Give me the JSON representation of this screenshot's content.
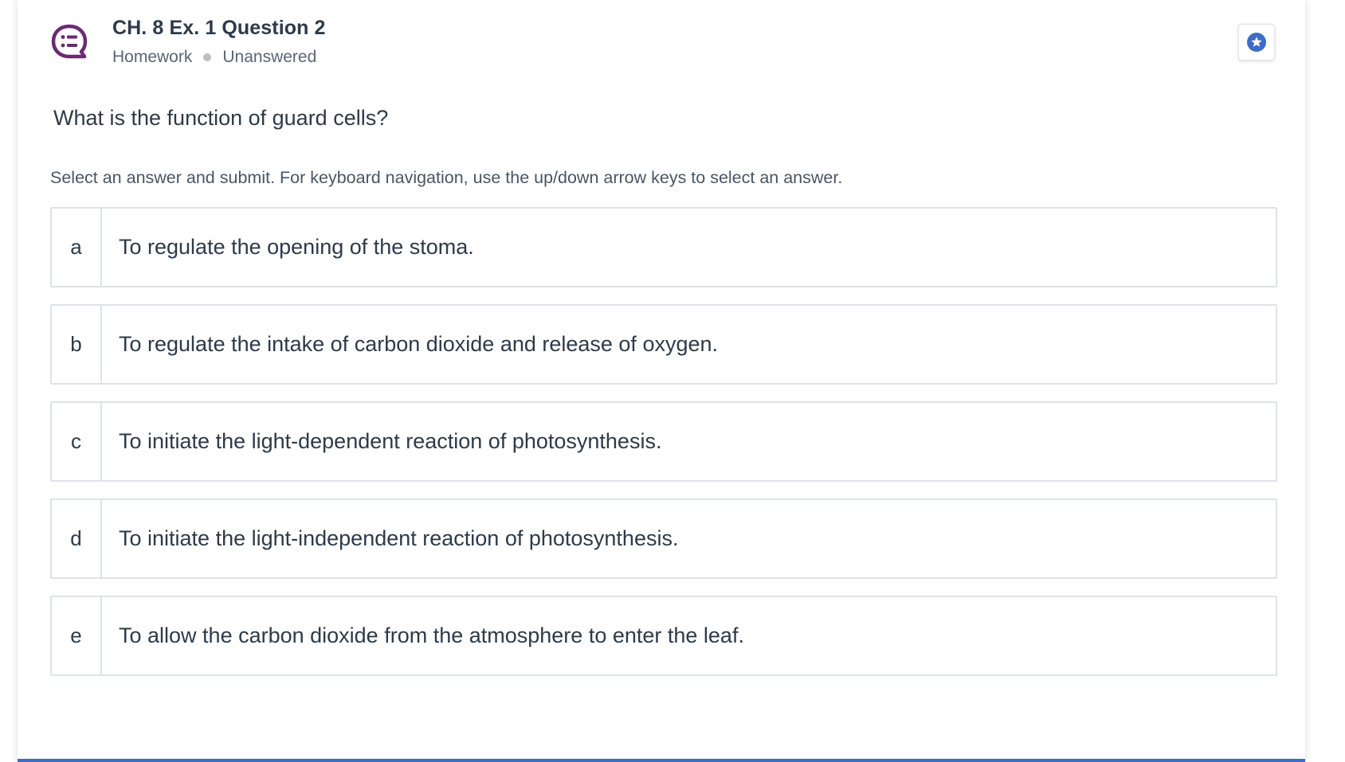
{
  "question": {
    "title": "CH. 8 Ex. 1 Question 2",
    "category": "Homework",
    "status": "Unanswered",
    "icon": "question-list-icon",
    "prompt": "What is the function of guard cells?",
    "instructions": "Select an answer and submit. For keyboard navigation, use the up/down arrow keys to select an answer."
  },
  "bookmark": {
    "icon": "star-badge-icon"
  },
  "options": [
    {
      "letter": "a",
      "text": "To regulate the opening of the stoma."
    },
    {
      "letter": "b",
      "text": "To regulate the intake of carbon dioxide and release of oxygen."
    },
    {
      "letter": "c",
      "text": "To initiate the light-dependent reaction of photosynthesis."
    },
    {
      "letter": "d",
      "text": "To initiate the light-independent reaction of photosynthesis."
    },
    {
      "letter": "e",
      "text": "To allow the carbon dioxide from the atmosphere to enter the leaf."
    }
  ],
  "colors": {
    "icon_accent": "#6b2a72",
    "bookmark_accent": "#3e6cc7",
    "bottom_bar": "#3e6cc7",
    "border": "#dfe2e6",
    "text": "#2e3a48"
  }
}
